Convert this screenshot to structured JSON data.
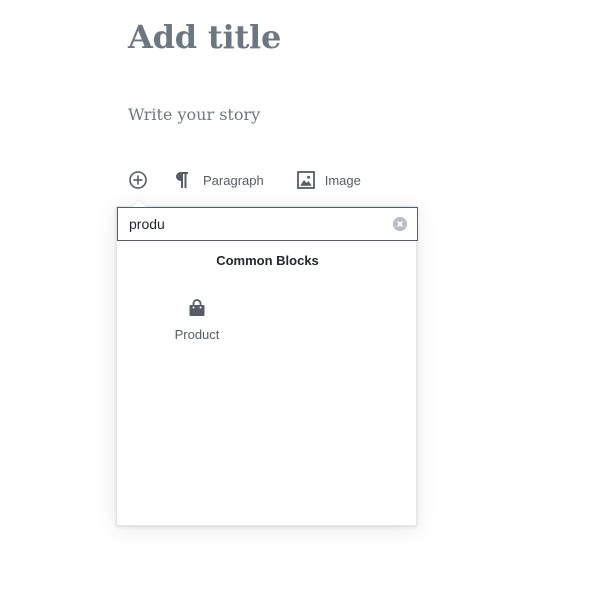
{
  "editor": {
    "title_placeholder": "Add title",
    "content_placeholder": "Write your story"
  },
  "toolbar": {
    "inserter_icon": "plus-circle-icon",
    "quick_blocks": [
      {
        "label": "Paragraph",
        "icon": "paragraph-icon"
      },
      {
        "label": "Image",
        "icon": "image-icon"
      }
    ]
  },
  "inserter": {
    "search": {
      "value": "produ",
      "clear_icon": "clear-icon"
    },
    "groups": [
      {
        "title": "Common Blocks",
        "blocks": [
          {
            "label": "Product",
            "icon": "shopping-bag-icon"
          }
        ]
      }
    ]
  },
  "colors": {
    "text": "#555d66",
    "title": "#6c7781",
    "border": "#e2e4e7",
    "input_border": "#555d66"
  }
}
